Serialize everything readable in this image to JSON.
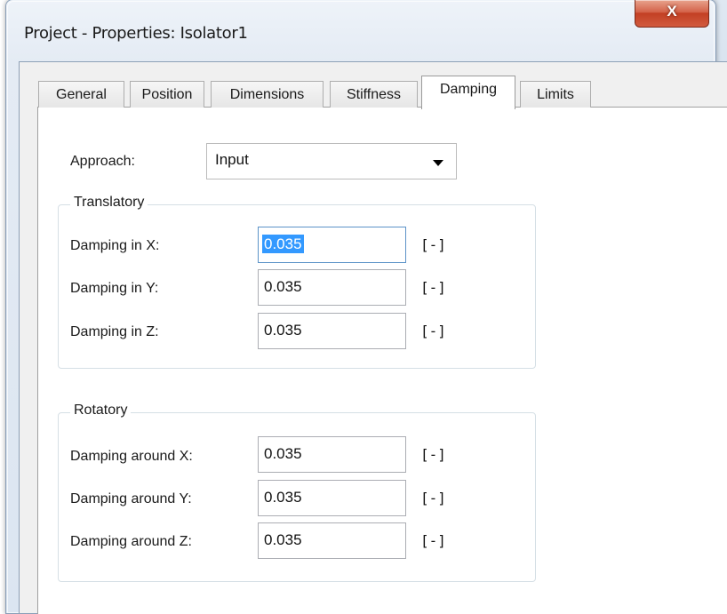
{
  "window": {
    "title": "Project - Properties: Isolator1",
    "close_glyph": "X"
  },
  "tabs": [
    {
      "label": "General",
      "active": false
    },
    {
      "label": "Position",
      "active": false
    },
    {
      "label": "Dimensions",
      "active": false
    },
    {
      "label": "Stiffness",
      "active": false
    },
    {
      "label": "Damping",
      "active": true
    },
    {
      "label": "Limits",
      "active": false
    }
  ],
  "approach": {
    "label": "Approach:",
    "value": "Input"
  },
  "translatory": {
    "title": "Translatory",
    "rows": [
      {
        "label": "Damping in X:",
        "value": "0.035",
        "unit": "[-]"
      },
      {
        "label": "Damping in Y:",
        "value": "0.035",
        "unit": "[-]"
      },
      {
        "label": "Damping in Z:",
        "value": "0.035",
        "unit": "[-]"
      }
    ]
  },
  "rotatory": {
    "title": "Rotatory",
    "rows": [
      {
        "label": "Damping around X:",
        "value": "0.035",
        "unit": "[-]"
      },
      {
        "label": "Damping around Y:",
        "value": "0.035",
        "unit": "[-]"
      },
      {
        "label": "Damping around Z:",
        "value": "0.035",
        "unit": "[-]"
      }
    ]
  },
  "colors": {
    "close_button": "#c8472b",
    "selection": "#3399ff",
    "focus_border": "#5c93c8"
  }
}
